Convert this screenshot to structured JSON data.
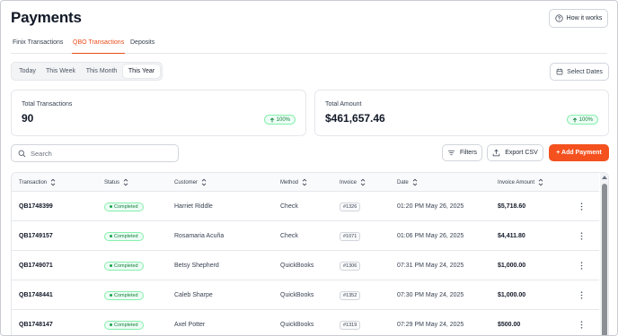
{
  "page": {
    "title": "Payments"
  },
  "header": {
    "how_it_works_label": "How it works"
  },
  "tabs": [
    {
      "label": "Finix Transactions",
      "active": false
    },
    {
      "label": "QBO Transactions",
      "active": true
    },
    {
      "label": "Deposits",
      "active": false
    }
  ],
  "date_range": {
    "options": [
      "Today",
      "This Week",
      "This Month",
      "This Year"
    ],
    "selected": "This Year",
    "select_dates_label": "Select Dates"
  },
  "summary": {
    "total_transactions": {
      "label": "Total Transactions",
      "value": "90",
      "badge": "100%"
    },
    "total_amount": {
      "label": "Total Amount",
      "value": "$461,657.46",
      "badge": "100%"
    }
  },
  "toolbar": {
    "search_placeholder": "Search",
    "filters_label": "Filters",
    "export_label": "Export CSV",
    "add_payment_label": "+ Add Payment"
  },
  "table": {
    "columns": [
      "Transaction",
      "Status",
      "Customer",
      "Method",
      "Invoice",
      "Date",
      "Invoice Amount"
    ],
    "rows": [
      {
        "transaction": "QB1748399",
        "status": "Completed",
        "customer": "Harriet Riddle",
        "method": "Check",
        "invoice": "#1326",
        "date": "01:20 PM May 26, 2025",
        "amount": "$5,718.60"
      },
      {
        "transaction": "QB1749157",
        "status": "Completed",
        "customer": "Rosamaria Acuña",
        "method": "Check",
        "invoice": "#1071",
        "date": "01:06 PM May 26, 2025",
        "amount": "$4,411.80"
      },
      {
        "transaction": "QB1749071",
        "status": "Completed",
        "customer": "Betsy Shepherd",
        "method": "QuickBooks",
        "invoice": "#1306",
        "date": "07:31 PM May 24, 2025",
        "amount": "$1,000.00"
      },
      {
        "transaction": "QB1748441",
        "status": "Completed",
        "customer": "Caleb Sharpe",
        "method": "QuickBooks",
        "invoice": "#1352",
        "date": "07:30 PM May 24, 2025",
        "amount": "$1,000.00"
      },
      {
        "transaction": "QB1748147",
        "status": "Completed",
        "customer": "Axel Potter",
        "method": "QuickBooks",
        "invoice": "#1319",
        "date": "07:29 PM May 24, 2025",
        "amount": "$500.00"
      }
    ]
  },
  "colors": {
    "accent": "#f4511e",
    "tab_active": "#ea4d1c",
    "success_text": "#15803d",
    "success_bg": "#ecfdf5",
    "success_border": "#86efac"
  },
  "icons": {
    "how_it_works": "help-circle-icon",
    "select_dates": "calendar-icon",
    "search": "search-icon",
    "filters": "filter-lines-icon",
    "export": "upload-icon",
    "sort": "sort-icon",
    "row_menu": "more-vertical-icon",
    "badge_trend": "arrow-up-icon"
  }
}
